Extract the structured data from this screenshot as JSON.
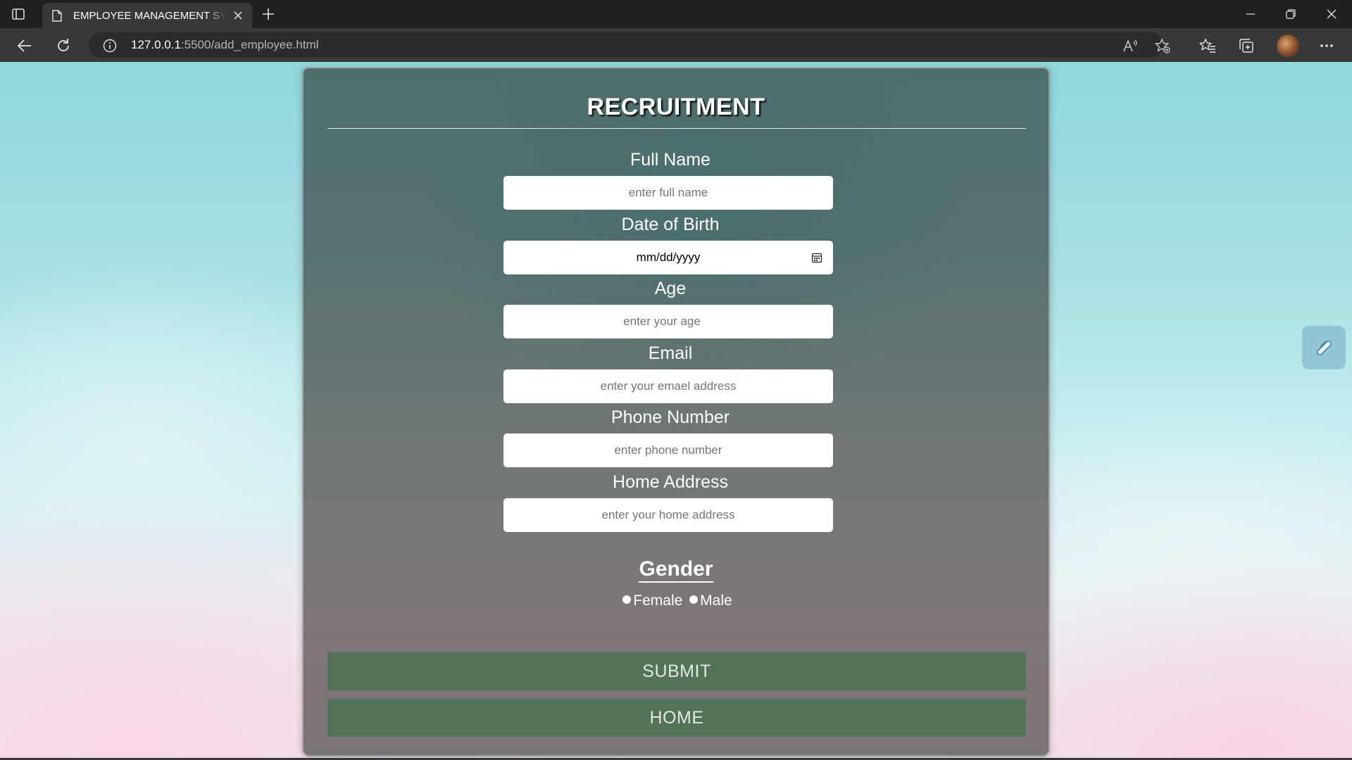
{
  "browser": {
    "tab_title": "EMPLOYEE MANAGEMENT SYSTEM",
    "url_host": "127.0.0.1",
    "url_path": ":5500/add_employee.html",
    "icons": [
      "sidebar-toggle-icon",
      "page-icon",
      "close-icon",
      "plus-icon",
      "minimize-icon",
      "restore-icon",
      "back-icon",
      "reload-icon",
      "info-icon",
      "read-aloud-icon",
      "add-favorite-icon",
      "favorites-icon",
      "collections-icon",
      "more-icon"
    ]
  },
  "form": {
    "title": "RECRUITMENT",
    "fields": [
      {
        "label": "Full Name",
        "placeholder": "enter full name"
      },
      {
        "label": "Date of Birth",
        "value": "mm/dd/yyyy"
      },
      {
        "label": "Age",
        "placeholder": "enter your age"
      },
      {
        "label": "Email",
        "placeholder": "enter your emael address"
      },
      {
        "label": "Phone Number",
        "placeholder": "enter phone number"
      },
      {
        "label": "Home Address",
        "placeholder": "enter your home address"
      }
    ],
    "gender": {
      "title": "Gender",
      "options": [
        "Female",
        "Male"
      ]
    },
    "submit_label": "SUBMIT",
    "home_label": "HOME"
  },
  "colors": {
    "button_bg": "#537358",
    "card_top": "#4f6f6d",
    "card_bottom": "#7b7475"
  }
}
